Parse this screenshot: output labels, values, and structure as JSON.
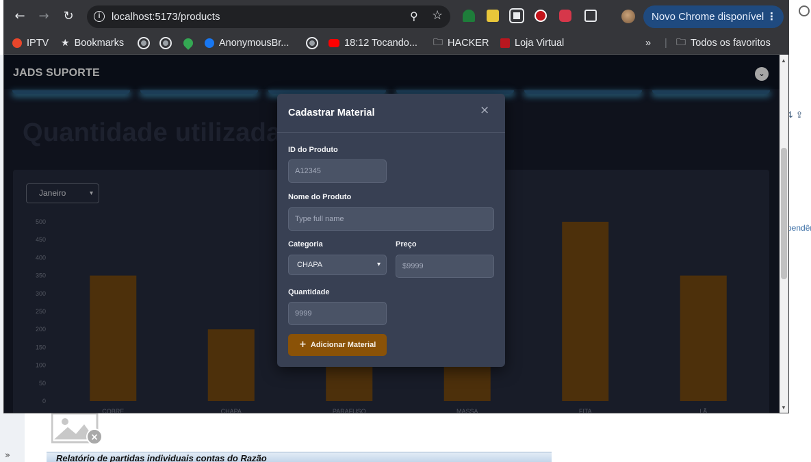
{
  "browser": {
    "url": "localhost:5173/products",
    "update_label": "Novo Chrome disponível",
    "bookmarks": [
      "IPTV",
      "Bookmarks",
      "AnonymousBr...",
      "18:12 Tocando...",
      "HACKER",
      "Loja Virtual"
    ],
    "overflow_label": "»",
    "all_bookmarks_label": "Todos os favoritos"
  },
  "app": {
    "title": "JADS SUPORTE",
    "page_heading": "Quantidade utilizada",
    "month_select": "Janeiro"
  },
  "chart_data": {
    "type": "bar",
    "categories": [
      "COBRE",
      "CHAPA",
      "PARAFUSO",
      "MASSA",
      "FITA",
      "LÃ"
    ],
    "values": [
      350,
      200,
      100,
      100,
      500,
      350
    ],
    "yticks": [
      0,
      50,
      100,
      150,
      200,
      250,
      300,
      350,
      400,
      450,
      500
    ],
    "ylim": [
      0,
      500
    ],
    "bar_color": "#774a12",
    "title": "",
    "xlabel": "",
    "ylabel": ""
  },
  "modal": {
    "title": "Cadastrar Material",
    "close_symbol": "×",
    "id_label": "ID do Produto",
    "id_placeholder": "A12345",
    "name_label": "Nome do Produto",
    "name_placeholder": "Type full name",
    "category_label": "Categoria",
    "category_value": "CHAPA",
    "price_label": "Preço",
    "price_placeholder": "$9999",
    "quantity_label": "Quantidade",
    "quantity_placeholder": "9999",
    "submit_label": "Adicionar Material"
  },
  "background": {
    "report_title": "Relatório de partidas individuais contas do Razão",
    "right_snippet": "pendên"
  },
  "colors": {
    "page_bg": "#171c2c",
    "card_bg": "#262c3e",
    "modal_bg": "#384053",
    "accent": "#8a5207",
    "glow": "#4ab0e2"
  }
}
